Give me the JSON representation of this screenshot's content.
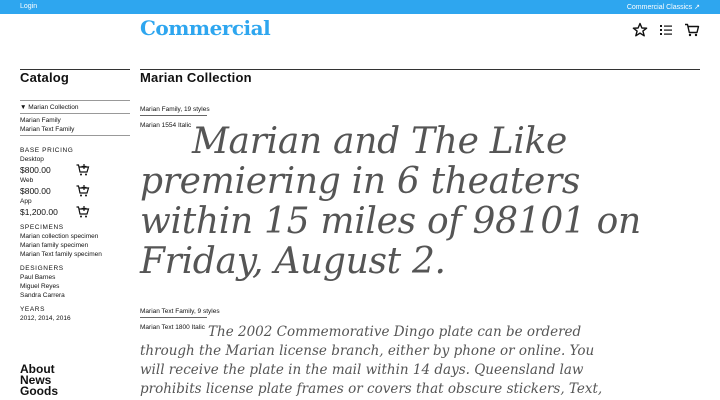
{
  "topbar": {
    "login": "Login",
    "classics": "Commercial Classics ↗",
    "color": "#2ea6ef"
  },
  "logo": "Commercial",
  "header_icons": [
    "star-icon",
    "list-icon",
    "cart-icon"
  ],
  "catalog": {
    "title": "Catalog",
    "collection": "▼ Marian Collection",
    "families": [
      "Marian Family",
      "Marian Text Family"
    ],
    "base_pricing": {
      "label": "Base Pricing",
      "items": [
        {
          "label": "Desktop",
          "price": "$800.00"
        },
        {
          "label": "Web",
          "price": "$800.00"
        },
        {
          "label": "App",
          "price": "$1,200.00"
        }
      ]
    },
    "specimens": {
      "label": "Specimens",
      "items": [
        "Marian collection specimen",
        "Marian family specimen",
        "Marian Text family specimen"
      ]
    },
    "designers": {
      "label": "Designers",
      "items": [
        "Paul Barnes",
        "Miguel Reyes",
        "Sandra Carrera"
      ]
    },
    "years": {
      "label": "Years",
      "value": "2012, 2014, 2016"
    },
    "footer_links": [
      "About",
      "News",
      "Goods"
    ]
  },
  "main": {
    "title": "Marian Collection",
    "family1": {
      "label": "Marian Family, 19 styles",
      "style": "Marian 1554 Italic",
      "text": "Marian and The Like premiering in 6 theaters within 15 miles of 98101 on Friday, August 2."
    },
    "family2": {
      "label": "Marian Text Family, 9 styles",
      "style": "Marian Text 1800 Italic",
      "text": "The 2002 Commemorative Dingo plate can be ordered through the Marian license branch, either by phone or online. You will receive the plate in the mail within 14 days. Queensland law prohibits license plate frames or covers that obscure stickers, Text, or numbers on your plate."
    }
  }
}
